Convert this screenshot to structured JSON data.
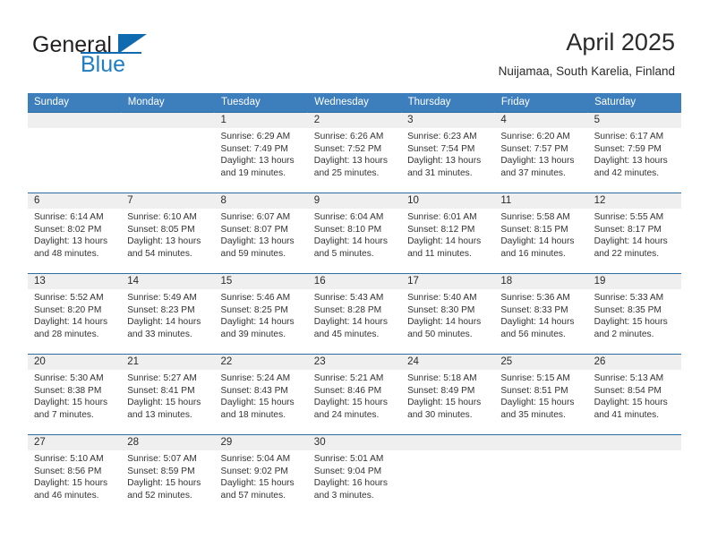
{
  "brand": {
    "name_part1": "General",
    "name_part2": "Blue",
    "logo_icon": "blue-triangle-icon"
  },
  "header": {
    "title": "April 2025",
    "subtitle": "Nuijamaa, South Karelia, Finland"
  },
  "colors": {
    "header_blue": "#3d7ebd",
    "divider_blue": "#2e6da4",
    "daynum_band": "#efefef",
    "brand_blue": "#1f7dc4",
    "text": "#2b2b2b"
  },
  "calendar": {
    "weekday_headers": [
      "Sunday",
      "Monday",
      "Tuesday",
      "Wednesday",
      "Thursday",
      "Friday",
      "Saturday"
    ],
    "labels": {
      "sunrise": "Sunrise:",
      "sunset": "Sunset:",
      "daylight": "Daylight:"
    },
    "weeks": [
      [
        {
          "day": "",
          "empty": true,
          "sunrise": "",
          "sunset": "",
          "daylight_line1": "",
          "daylight_line2": ""
        },
        {
          "day": "",
          "empty": true,
          "sunrise": "",
          "sunset": "",
          "daylight_line1": "",
          "daylight_line2": ""
        },
        {
          "day": "1",
          "sunrise": "Sunrise: 6:29 AM",
          "sunset": "Sunset: 7:49 PM",
          "daylight_line1": "Daylight: 13 hours",
          "daylight_line2": "and 19 minutes."
        },
        {
          "day": "2",
          "sunrise": "Sunrise: 6:26 AM",
          "sunset": "Sunset: 7:52 PM",
          "daylight_line1": "Daylight: 13 hours",
          "daylight_line2": "and 25 minutes."
        },
        {
          "day": "3",
          "sunrise": "Sunrise: 6:23 AM",
          "sunset": "Sunset: 7:54 PM",
          "daylight_line1": "Daylight: 13 hours",
          "daylight_line2": "and 31 minutes."
        },
        {
          "day": "4",
          "sunrise": "Sunrise: 6:20 AM",
          "sunset": "Sunset: 7:57 PM",
          "daylight_line1": "Daylight: 13 hours",
          "daylight_line2": "and 37 minutes."
        },
        {
          "day": "5",
          "sunrise": "Sunrise: 6:17 AM",
          "sunset": "Sunset: 7:59 PM",
          "daylight_line1": "Daylight: 13 hours",
          "daylight_line2": "and 42 minutes."
        }
      ],
      [
        {
          "day": "6",
          "sunrise": "Sunrise: 6:14 AM",
          "sunset": "Sunset: 8:02 PM",
          "daylight_line1": "Daylight: 13 hours",
          "daylight_line2": "and 48 minutes."
        },
        {
          "day": "7",
          "sunrise": "Sunrise: 6:10 AM",
          "sunset": "Sunset: 8:05 PM",
          "daylight_line1": "Daylight: 13 hours",
          "daylight_line2": "and 54 minutes."
        },
        {
          "day": "8",
          "sunrise": "Sunrise: 6:07 AM",
          "sunset": "Sunset: 8:07 PM",
          "daylight_line1": "Daylight: 13 hours",
          "daylight_line2": "and 59 minutes."
        },
        {
          "day": "9",
          "sunrise": "Sunrise: 6:04 AM",
          "sunset": "Sunset: 8:10 PM",
          "daylight_line1": "Daylight: 14 hours",
          "daylight_line2": "and 5 minutes."
        },
        {
          "day": "10",
          "sunrise": "Sunrise: 6:01 AM",
          "sunset": "Sunset: 8:12 PM",
          "daylight_line1": "Daylight: 14 hours",
          "daylight_line2": "and 11 minutes."
        },
        {
          "day": "11",
          "sunrise": "Sunrise: 5:58 AM",
          "sunset": "Sunset: 8:15 PM",
          "daylight_line1": "Daylight: 14 hours",
          "daylight_line2": "and 16 minutes."
        },
        {
          "day": "12",
          "sunrise": "Sunrise: 5:55 AM",
          "sunset": "Sunset: 8:17 PM",
          "daylight_line1": "Daylight: 14 hours",
          "daylight_line2": "and 22 minutes."
        }
      ],
      [
        {
          "day": "13",
          "sunrise": "Sunrise: 5:52 AM",
          "sunset": "Sunset: 8:20 PM",
          "daylight_line1": "Daylight: 14 hours",
          "daylight_line2": "and 28 minutes."
        },
        {
          "day": "14",
          "sunrise": "Sunrise: 5:49 AM",
          "sunset": "Sunset: 8:23 PM",
          "daylight_line1": "Daylight: 14 hours",
          "daylight_line2": "and 33 minutes."
        },
        {
          "day": "15",
          "sunrise": "Sunrise: 5:46 AM",
          "sunset": "Sunset: 8:25 PM",
          "daylight_line1": "Daylight: 14 hours",
          "daylight_line2": "and 39 minutes."
        },
        {
          "day": "16",
          "sunrise": "Sunrise: 5:43 AM",
          "sunset": "Sunset: 8:28 PM",
          "daylight_line1": "Daylight: 14 hours",
          "daylight_line2": "and 45 minutes."
        },
        {
          "day": "17",
          "sunrise": "Sunrise: 5:40 AM",
          "sunset": "Sunset: 8:30 PM",
          "daylight_line1": "Daylight: 14 hours",
          "daylight_line2": "and 50 minutes."
        },
        {
          "day": "18",
          "sunrise": "Sunrise: 5:36 AM",
          "sunset": "Sunset: 8:33 PM",
          "daylight_line1": "Daylight: 14 hours",
          "daylight_line2": "and 56 minutes."
        },
        {
          "day": "19",
          "sunrise": "Sunrise: 5:33 AM",
          "sunset": "Sunset: 8:35 PM",
          "daylight_line1": "Daylight: 15 hours",
          "daylight_line2": "and 2 minutes."
        }
      ],
      [
        {
          "day": "20",
          "sunrise": "Sunrise: 5:30 AM",
          "sunset": "Sunset: 8:38 PM",
          "daylight_line1": "Daylight: 15 hours",
          "daylight_line2": "and 7 minutes."
        },
        {
          "day": "21",
          "sunrise": "Sunrise: 5:27 AM",
          "sunset": "Sunset: 8:41 PM",
          "daylight_line1": "Daylight: 15 hours",
          "daylight_line2": "and 13 minutes."
        },
        {
          "day": "22",
          "sunrise": "Sunrise: 5:24 AM",
          "sunset": "Sunset: 8:43 PM",
          "daylight_line1": "Daylight: 15 hours",
          "daylight_line2": "and 18 minutes."
        },
        {
          "day": "23",
          "sunrise": "Sunrise: 5:21 AM",
          "sunset": "Sunset: 8:46 PM",
          "daylight_line1": "Daylight: 15 hours",
          "daylight_line2": "and 24 minutes."
        },
        {
          "day": "24",
          "sunrise": "Sunrise: 5:18 AM",
          "sunset": "Sunset: 8:49 PM",
          "daylight_line1": "Daylight: 15 hours",
          "daylight_line2": "and 30 minutes."
        },
        {
          "day": "25",
          "sunrise": "Sunrise: 5:15 AM",
          "sunset": "Sunset: 8:51 PM",
          "daylight_line1": "Daylight: 15 hours",
          "daylight_line2": "and 35 minutes."
        },
        {
          "day": "26",
          "sunrise": "Sunrise: 5:13 AM",
          "sunset": "Sunset: 8:54 PM",
          "daylight_line1": "Daylight: 15 hours",
          "daylight_line2": "and 41 minutes."
        }
      ],
      [
        {
          "day": "27",
          "sunrise": "Sunrise: 5:10 AM",
          "sunset": "Sunset: 8:56 PM",
          "daylight_line1": "Daylight: 15 hours",
          "daylight_line2": "and 46 minutes."
        },
        {
          "day": "28",
          "sunrise": "Sunrise: 5:07 AM",
          "sunset": "Sunset: 8:59 PM",
          "daylight_line1": "Daylight: 15 hours",
          "daylight_line2": "and 52 minutes."
        },
        {
          "day": "29",
          "sunrise": "Sunrise: 5:04 AM",
          "sunset": "Sunset: 9:02 PM",
          "daylight_line1": "Daylight: 15 hours",
          "daylight_line2": "and 57 minutes."
        },
        {
          "day": "30",
          "sunrise": "Sunrise: 5:01 AM",
          "sunset": "Sunset: 9:04 PM",
          "daylight_line1": "Daylight: 16 hours",
          "daylight_line2": "and 3 minutes."
        },
        {
          "day": "",
          "empty": true,
          "sunrise": "",
          "sunset": "",
          "daylight_line1": "",
          "daylight_line2": ""
        },
        {
          "day": "",
          "empty": true,
          "sunrise": "",
          "sunset": "",
          "daylight_line1": "",
          "daylight_line2": ""
        },
        {
          "day": "",
          "empty": true,
          "sunrise": "",
          "sunset": "",
          "daylight_line1": "",
          "daylight_line2": ""
        }
      ]
    ]
  }
}
